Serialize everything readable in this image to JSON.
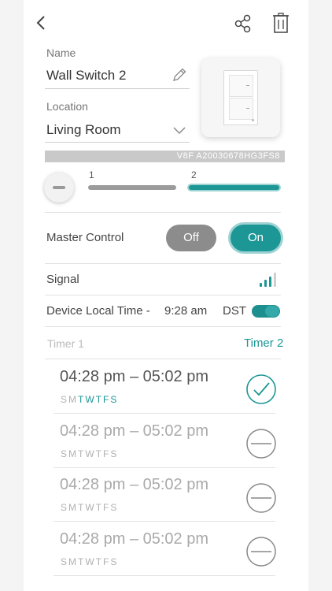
{
  "header": {
    "back_icon": "chevron-left-icon",
    "share_icon": "share-icon",
    "delete_icon": "trash-icon"
  },
  "name_field": {
    "label": "Name",
    "value": "Wall Switch 2",
    "edit_icon": "pencil-icon"
  },
  "location_field": {
    "label": "Location",
    "value": "Living Room",
    "dropdown_icon": "chevron-down-icon"
  },
  "serial": "V8F  A20030678HG3FS8",
  "slots": {
    "items": [
      {
        "number": "1",
        "active": false
      },
      {
        "number": "2",
        "active": true
      }
    ]
  },
  "master_control": {
    "label": "Master Control",
    "off_label": "Off",
    "on_label": "On",
    "state": "On"
  },
  "signal": {
    "label": "Signal",
    "strength_bars": 3,
    "total_bars": 4
  },
  "local_time": {
    "label": "Device Local Time -",
    "time": "9:28 am",
    "dst_label": "DST",
    "dst_enabled": true
  },
  "timer_tabs": [
    {
      "label": "Timer 1",
      "active": false
    },
    {
      "label": "Timer 2",
      "active": true
    }
  ],
  "timers": [
    {
      "time": "04:28 pm – 05:02 pm",
      "days": [
        "S",
        "M",
        "T",
        "W",
        "T",
        "F",
        "S"
      ],
      "days_on": [
        false,
        false,
        true,
        true,
        true,
        true,
        true
      ],
      "status": "check",
      "active": true
    },
    {
      "time": "04:28 pm – 05:02 pm",
      "days": [
        "S",
        "M",
        "T",
        "W",
        "T",
        "F",
        "S"
      ],
      "days_on": [
        false,
        false,
        false,
        false,
        false,
        false,
        false
      ],
      "status": "minus",
      "active": false
    },
    {
      "time": "04:28 pm – 05:02 pm",
      "days": [
        "S",
        "M",
        "T",
        "W",
        "T",
        "F",
        "S"
      ],
      "days_on": [
        false,
        false,
        false,
        false,
        false,
        false,
        false
      ],
      "status": "minus",
      "active": false
    },
    {
      "time": "04:28 pm – 05:02 pm",
      "days": [
        "S",
        "M",
        "T",
        "W",
        "T",
        "F",
        "S"
      ],
      "days_on": [
        false,
        false,
        false,
        false,
        false,
        false,
        false
      ],
      "status": "minus",
      "active": false
    }
  ],
  "colors": {
    "accent": "#1d9696",
    "off_grey": "#8c8c8c",
    "bar_grey": "#9b9b9b"
  }
}
